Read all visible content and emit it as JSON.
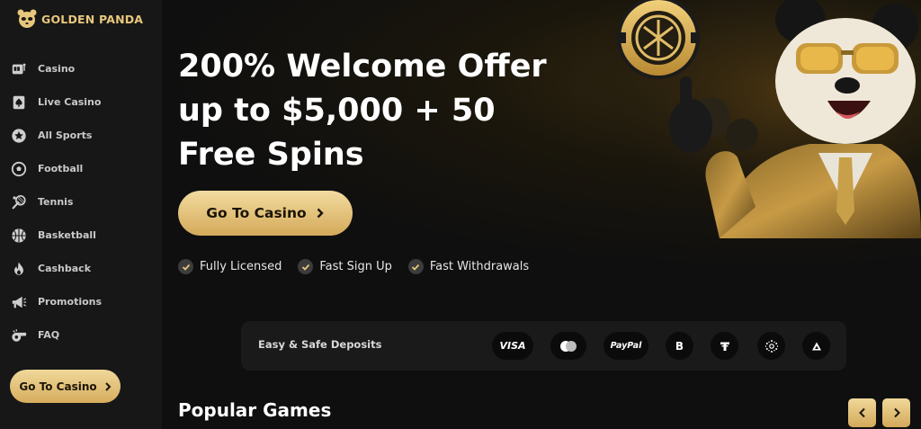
{
  "brand": {
    "name": "GOLDEN PANDA"
  },
  "colors": {
    "accent": "#e7c77c",
    "button_top": "#f2dba0",
    "button_bottom": "#d4aa5a"
  },
  "sidebar": {
    "items": [
      {
        "label": "Casino",
        "icon": "slot-machine-icon"
      },
      {
        "label": "Live Casino",
        "icon": "spade-card-icon"
      },
      {
        "label": "All Sports",
        "icon": "star-badge-icon"
      },
      {
        "label": "Football",
        "icon": "football-icon"
      },
      {
        "label": "Tennis",
        "icon": "tennis-racket-icon"
      },
      {
        "label": "Basketball",
        "icon": "basketball-icon"
      },
      {
        "label": "Cashback",
        "icon": "flame-icon"
      },
      {
        "label": "Promotions",
        "icon": "megaphone-icon"
      },
      {
        "label": "FAQ",
        "icon": "whistle-icon"
      }
    ],
    "cta_label": "Go To Casino"
  },
  "hero": {
    "title_line1": "200% Welcome Offer",
    "title_line2": "up to $5,000 + 50",
    "title_line3": "Free Spins",
    "cta_label": "Go To Casino",
    "features": [
      "Fully Licensed",
      "Fast Sign Up",
      "Fast Withdrawals"
    ]
  },
  "deposits": {
    "label": "Easy & Safe Deposits",
    "methods": {
      "visa": "VISA",
      "paypal": "PayPal",
      "bitcoin": "B"
    },
    "icons": [
      "visa-icon",
      "mastercard-icon",
      "paypal-icon",
      "bitcoin-icon",
      "tether-icon",
      "cardano-icon",
      "tron-icon"
    ]
  },
  "popular_games": {
    "title": "Popular Games"
  }
}
